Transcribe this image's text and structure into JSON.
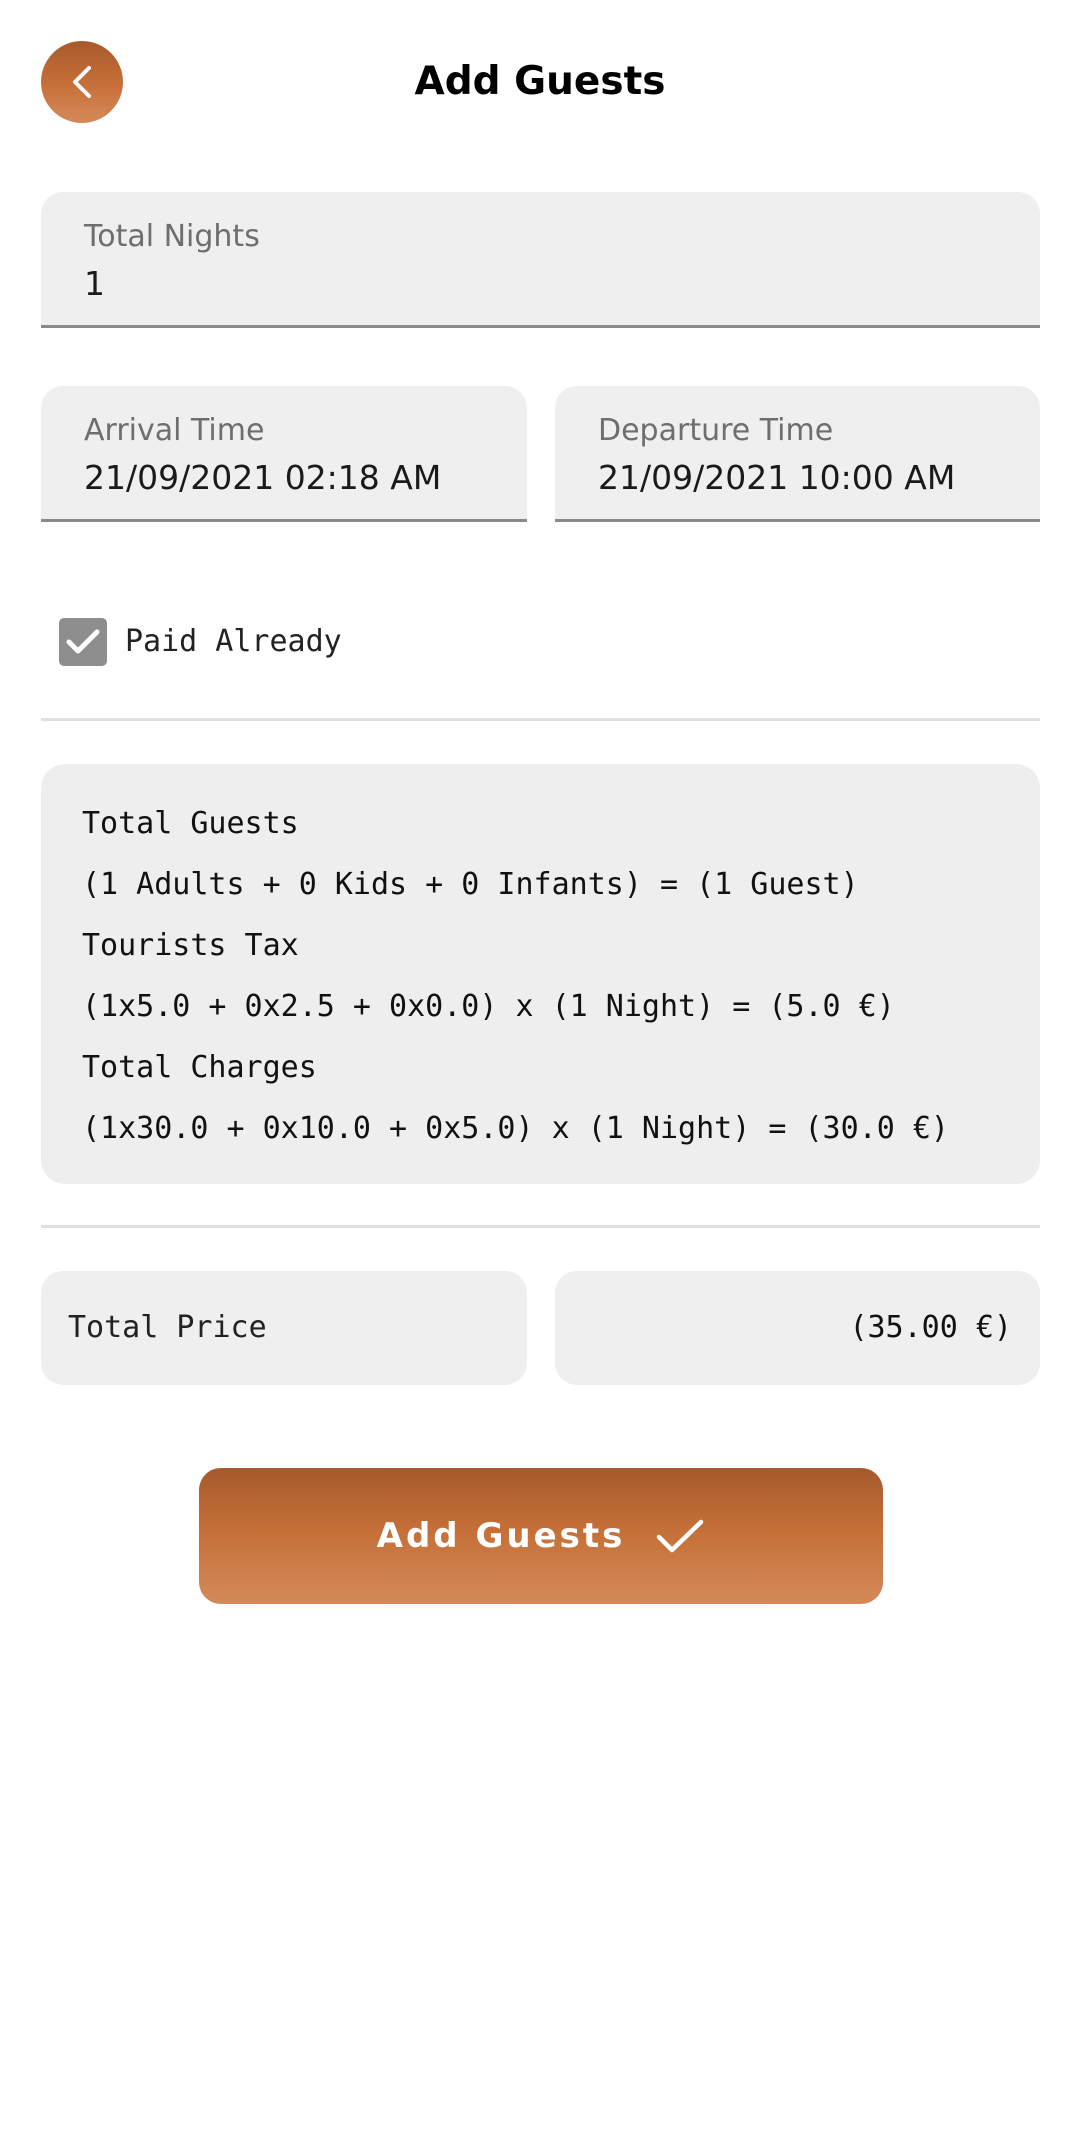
{
  "header": {
    "title": "Add Guests",
    "back_icon": "chevron-left-icon"
  },
  "fields": {
    "total_nights": {
      "label": "Total Nights",
      "value": "1"
    },
    "arrival_time": {
      "label": "Arrival Time",
      "value": "21/09/2021 02:18 AM"
    },
    "departure_time": {
      "label": "Departure Time",
      "value": "21/09/2021 10:00 AM"
    }
  },
  "paid_already": {
    "label": "Paid Already",
    "checked": true
  },
  "summary": {
    "total_guests_title": "Total Guests",
    "total_guests_detail": "(1 Adults + 0 Kids + 0 Infants) = (1 Guest)",
    "tourists_tax_title": "Tourists Tax",
    "tourists_tax_detail": "(1x5.0 + 0x2.5 + 0x0.0) x (1 Night) = (5.0 €)",
    "total_charges_title": "Total Charges",
    "total_charges_detail": "(1x30.0 + 0x10.0 + 0x5.0) x (1 Night) = (30.0 €)"
  },
  "total_price": {
    "label": "Total Price",
    "value": "(35.00 €)"
  },
  "primary_button": {
    "label": "Add Guests",
    "icon": "check-icon"
  },
  "colors": {
    "accent": "#c56f38",
    "accent_dark": "#a55a2c",
    "field_bg": "#efefef",
    "checkbox": "#8e8e8e"
  }
}
